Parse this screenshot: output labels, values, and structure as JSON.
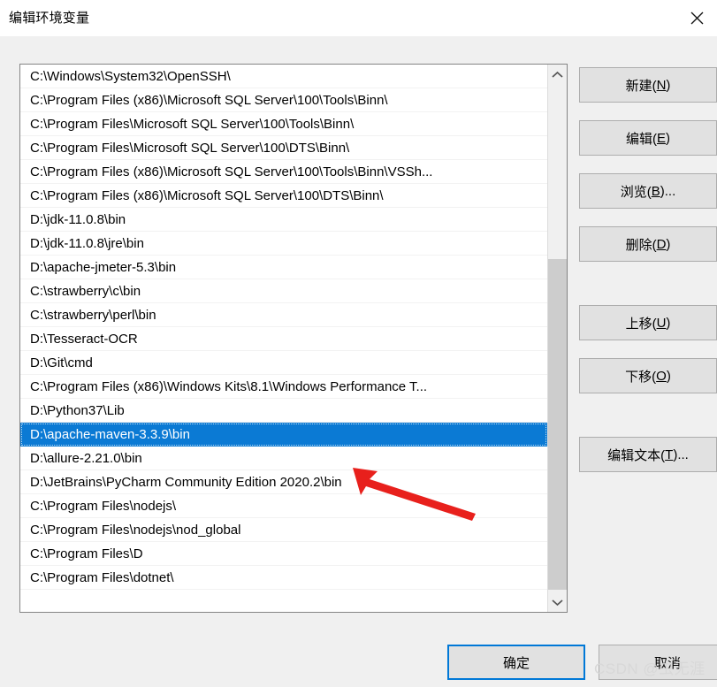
{
  "window": {
    "title": "编辑环境变量",
    "close_icon": "close-icon"
  },
  "path_list": {
    "selected_index": 15,
    "items": [
      "C:\\Windows\\System32\\OpenSSH\\",
      "C:\\Program Files (x86)\\Microsoft SQL Server\\100\\Tools\\Binn\\",
      "C:\\Program Files\\Microsoft SQL Server\\100\\Tools\\Binn\\",
      "C:\\Program Files\\Microsoft SQL Server\\100\\DTS\\Binn\\",
      "C:\\Program Files (x86)\\Microsoft SQL Server\\100\\Tools\\Binn\\VSSh...",
      "C:\\Program Files (x86)\\Microsoft SQL Server\\100\\DTS\\Binn\\",
      "D:\\jdk-11.0.8\\bin",
      "D:\\jdk-11.0.8\\jre\\bin",
      "D:\\apache-jmeter-5.3\\bin",
      "C:\\strawberry\\c\\bin",
      "C:\\strawberry\\perl\\bin",
      "D:\\Tesseract-OCR",
      "D:\\Git\\cmd",
      "C:\\Program Files (x86)\\Windows Kits\\8.1\\Windows Performance T...",
      "D:\\Python37\\Lib",
      "D:\\apache-maven-3.3.9\\bin",
      "D:\\allure-2.21.0\\bin",
      "D:\\JetBrains\\PyCharm Community Edition 2020.2\\bin",
      "C:\\Program Files\\nodejs\\",
      "C:\\Program Files\\nodejs\\nod_global",
      "C:\\Program Files\\D",
      "C:\\Program Files\\dotnet\\"
    ]
  },
  "scrollbar": {
    "up_arrow_icon": "chevron-up-icon",
    "down_arrow_icon": "chevron-down-icon"
  },
  "side_buttons": {
    "new": {
      "text": "新建(N)",
      "accel": "N"
    },
    "edit": {
      "text": "编辑(E)",
      "accel": "E"
    },
    "browse": {
      "text": "浏览(B)...",
      "accel": "B"
    },
    "delete": {
      "text": "删除(D)",
      "accel": "D"
    },
    "move_up": {
      "text": "上移(U)",
      "accel": "U"
    },
    "move_down": {
      "text": "下移(O)",
      "accel": "O"
    },
    "edit_text": {
      "text": "编辑文本(T)...",
      "accel": "T"
    }
  },
  "bottom_buttons": {
    "ok": "确定",
    "cancel": "取消"
  },
  "annotation": {
    "arrow_color": "#e8201c",
    "watermark": "CSDN @虫无涯"
  },
  "colors": {
    "selection_blue": "#0b7ad4",
    "focus_blue": "#0078d7",
    "dialog_bg": "#f0f0f0",
    "button_bg": "#e1e1e1",
    "button_border": "#adadad",
    "scrollbar_thumb": "#cdcdcd"
  }
}
